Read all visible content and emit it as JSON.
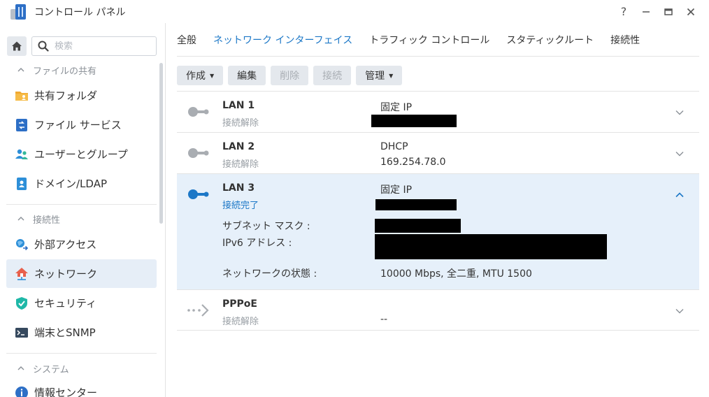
{
  "window": {
    "title": "コントロール パネル",
    "controls": [
      "?",
      "—",
      "□",
      "✕"
    ]
  },
  "sidebar": {
    "search_placeholder": "検索",
    "sections": [
      {
        "header": "ファイルの共有",
        "items": [
          {
            "label": "共有フォルダ",
            "icon": "folder-icon"
          },
          {
            "label": "ファイル サービス",
            "icon": "file-service-icon"
          },
          {
            "label": "ユーザーとグループ",
            "icon": "users-icon"
          },
          {
            "label": "ドメイン/LDAP",
            "icon": "domain-icon"
          }
        ]
      },
      {
        "header": "接続性",
        "items": [
          {
            "label": "外部アクセス",
            "icon": "external-access-icon"
          },
          {
            "label": "ネットワーク",
            "icon": "network-icon",
            "active": true
          },
          {
            "label": "セキュリティ",
            "icon": "shield-icon"
          },
          {
            "label": "端末とSNMP",
            "icon": "terminal-icon"
          }
        ]
      },
      {
        "header": "システム",
        "items": [
          {
            "label": "情報センター",
            "icon": "info-icon"
          }
        ]
      }
    ]
  },
  "tabs": [
    {
      "label": "全般",
      "active": false
    },
    {
      "label": "ネットワーク インターフェイス",
      "active": true
    },
    {
      "label": "トラフィック コントロール",
      "active": false
    },
    {
      "label": "スタティックルート",
      "active": false
    },
    {
      "label": "接続性",
      "active": false
    }
  ],
  "toolbar": {
    "create": "作成",
    "edit": "編集",
    "delete": "削除",
    "connect": "接続",
    "manage": "管理"
  },
  "interfaces": [
    {
      "name": "LAN 1",
      "status": "接続解除",
      "type": "固定 IP",
      "value": ""
    },
    {
      "name": "LAN 2",
      "status": "接続解除",
      "type": "DHCP",
      "value": "169.254.78.0"
    },
    {
      "name": "LAN 3",
      "status": "接続完了",
      "type": "固定 IP",
      "value": "",
      "details": {
        "subnet_label": "サブネット マスク :",
        "ipv6_label": "IPv6 アドレス :",
        "state_label": "ネットワークの状態 :",
        "state_value": "10000 Mbps, 全二重, MTU 1500"
      }
    },
    {
      "name": "PPPoE",
      "status": "接続解除",
      "type": "",
      "value": "--"
    }
  ],
  "colors": {
    "accent": "#1d78c7",
    "active_bg": "#e6eef7",
    "expanded_bg": "#e6f0fa",
    "muted": "#9aa0a6"
  }
}
